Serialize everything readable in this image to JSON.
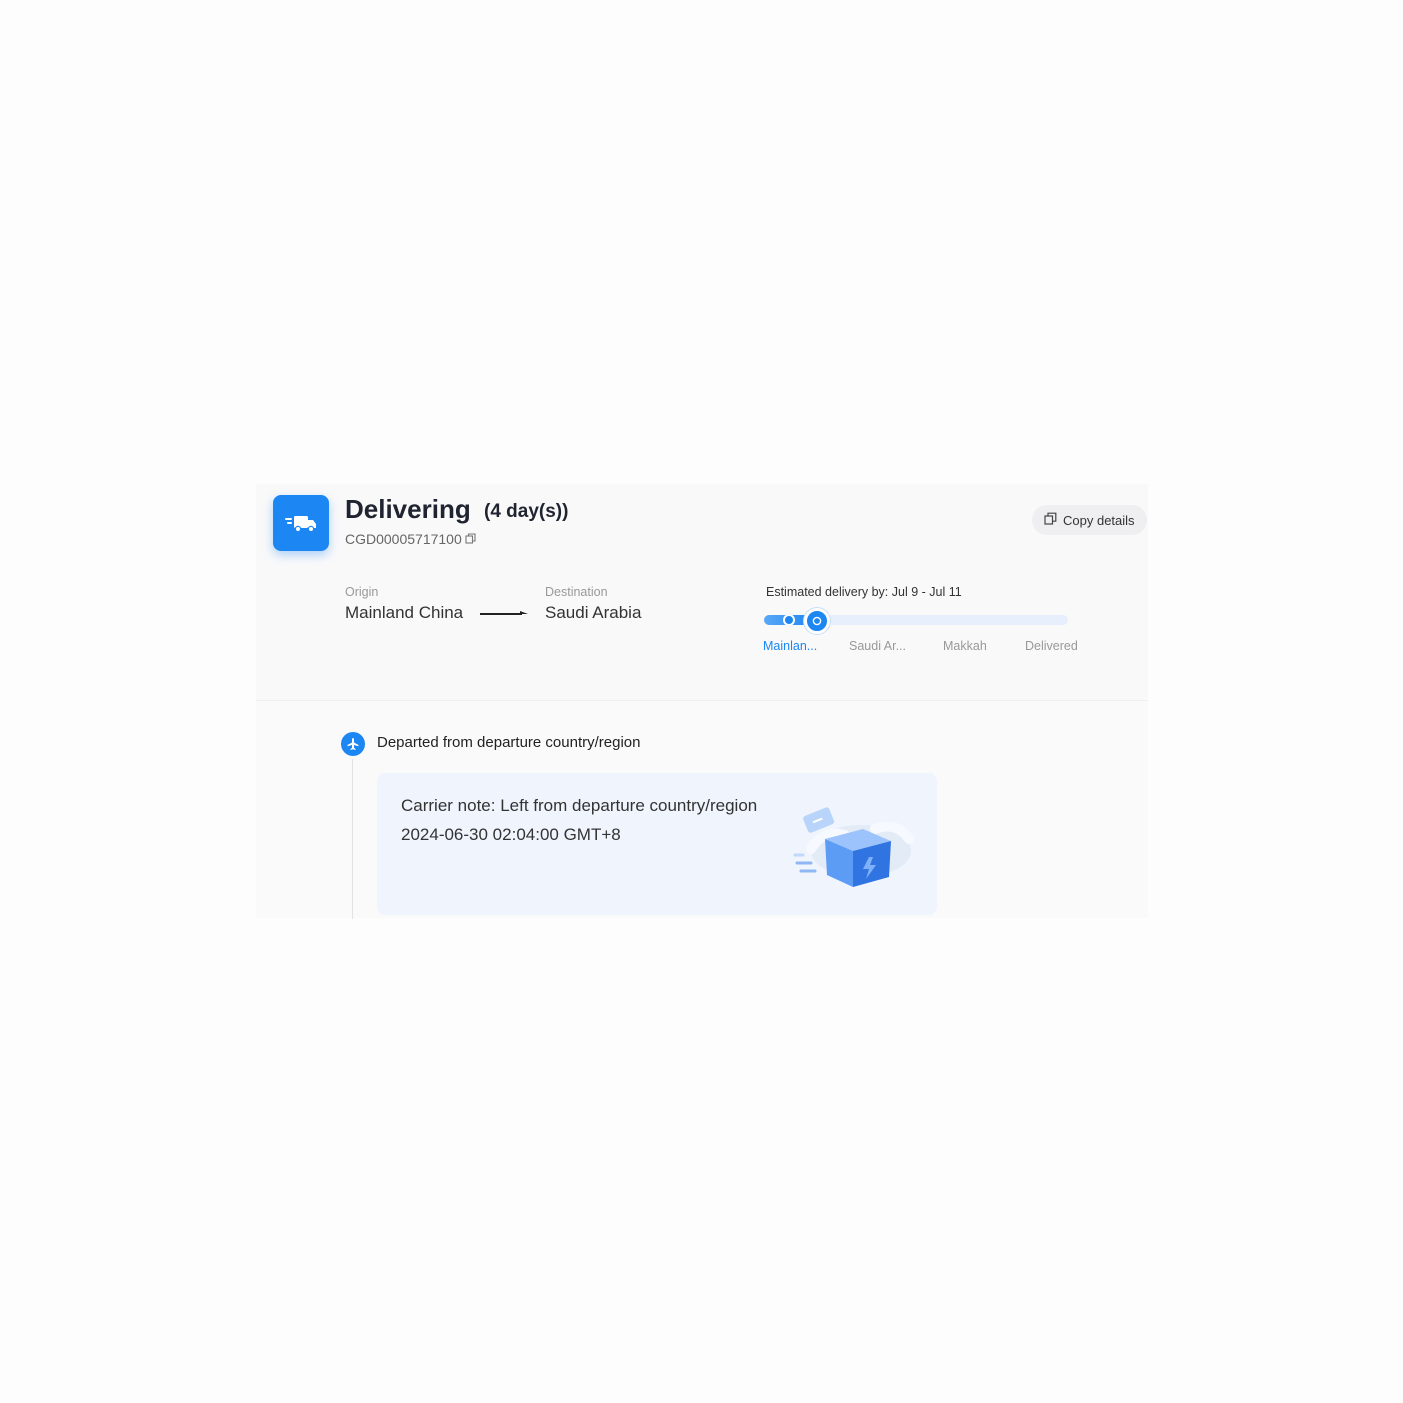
{
  "status": {
    "title": "Delivering",
    "duration": "(4 day(s))",
    "tracking_number": "CGD00005717100"
  },
  "actions": {
    "copy_details_label": "Copy details"
  },
  "route": {
    "origin_label": "Origin",
    "origin_value": "Mainland China",
    "destination_label": "Destination",
    "destination_value": "Saudi Arabia"
  },
  "progress": {
    "eta_text": "Estimated delivery by:  Jul 9 - Jul 11",
    "fraction_complete": 0.17,
    "stops": [
      {
        "label": "Mainlan...",
        "active": true
      },
      {
        "label": "Saudi Ar...",
        "active": false
      },
      {
        "label": "Makkah",
        "active": false
      },
      {
        "label": "Delivered",
        "active": false
      }
    ]
  },
  "events": [
    {
      "icon": "airplane-icon",
      "title": "Departed from departure country/region",
      "note": "Carrier note: Left from departure country/region",
      "timestamp": "2024-06-30 02:04:00 GMT+8"
    }
  ],
  "colors": {
    "accent": "#1c86f2",
    "note_bg": "#eff4fd",
    "track_bg": "#e6effb"
  }
}
